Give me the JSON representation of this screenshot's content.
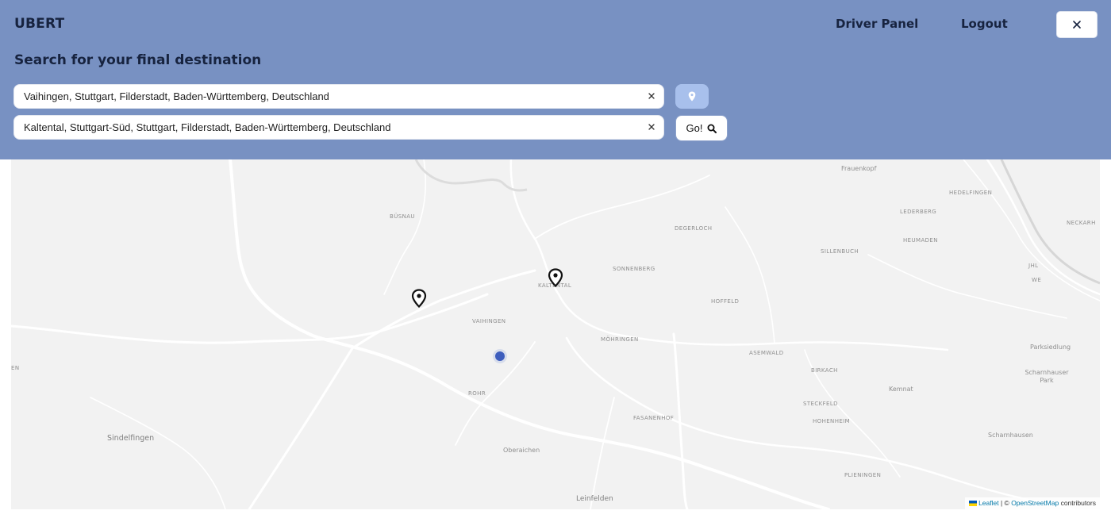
{
  "header": {
    "brand": "UBERT",
    "nav": {
      "driver_panel": "Driver Panel",
      "logout": "Logout"
    },
    "close_icon": "close-icon",
    "background_color": "#7891c2",
    "text_color": "#17233f"
  },
  "search": {
    "heading": "Search for your final destination",
    "from_value": "Vaihingen, Stuttgart, Filderstadt, Baden-Württemberg, Deutschland",
    "to_value": "Kaltental, Stuttgart-Süd, Stuttgart, Filderstadt, Baden-Württemberg, Deutschland",
    "clear_label": "×",
    "location_button_icon": "map-pin-icon",
    "go_label": "Go!",
    "go_icon": "search-icon"
  },
  "map": {
    "places": [
      "Frauenkopf",
      "HEDELFINGEN",
      "LEDERBERG",
      "BÜSNAU",
      "DEGERLOCH",
      "NECKARH",
      "HEUMADEN",
      "SILLENBUCH",
      "JHL",
      "SONNENBERG",
      "KALTENTAL",
      "WE",
      "HOFFELD",
      "VAIHINGEN",
      "MÖHRINGEN",
      "Parksiedlung",
      "ASEMWALD",
      "EN",
      "BIRKACH",
      "Scharnhauser Park",
      "Kemnat",
      "ROHR",
      "STECKFELD",
      "HOHENHEIM",
      "FASANENHOF",
      "Sindelfingen",
      "Scharnhausen",
      "Oberaichen",
      "PLIENINGEN",
      "Leinfelden"
    ],
    "markers": [
      "origin-marker",
      "destination-marker"
    ],
    "user_location": "user-location-dot",
    "attribution": {
      "leaflet": "Leaflet",
      "separator": "| ©",
      "osm": "OpenStreetMap",
      "suffix": "contributors"
    }
  }
}
